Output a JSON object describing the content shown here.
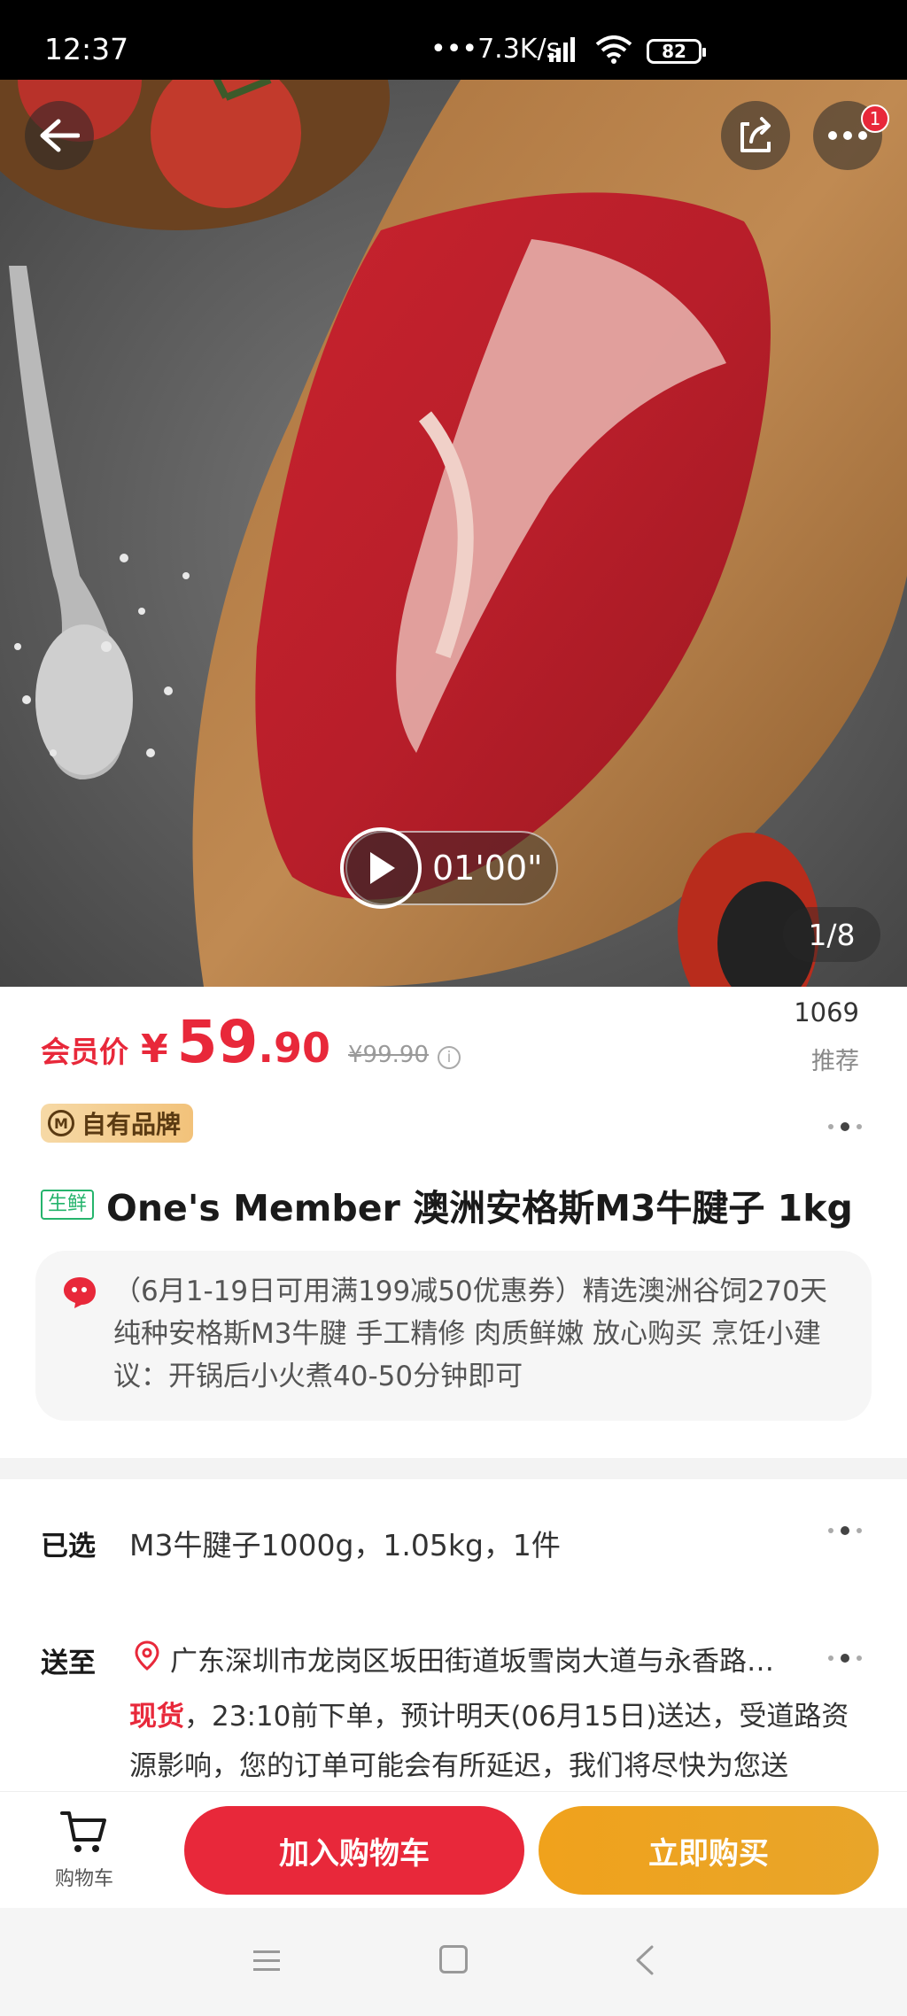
{
  "status_bar": {
    "time": "12:37",
    "net_speed": "•••7.3K/s",
    "battery": "82"
  },
  "hero": {
    "image_counter": "1/8",
    "video_duration": "01'00\"",
    "more_badge": "1"
  },
  "price": {
    "member_label": "会员价",
    "currency": "¥",
    "integer": "59",
    "decimal": ".90",
    "original": "¥99.90",
    "info_icon_text": "i"
  },
  "recommend": {
    "count": "1069",
    "label": "推荐"
  },
  "brand_tag": {
    "icon_text": "M",
    "label": "自有品牌"
  },
  "product": {
    "fresh_tag": "生鲜",
    "title": "One's Member 澳洲安格斯M3牛腱子 1kg",
    "description": "（6月1-19日可用满199减50优惠券）精选澳洲谷饲270天纯种安格斯M3牛腱 手工精修 肉质鲜嫩 放心购买 烹饪小建议：开锅后小火煮40-50分钟即可"
  },
  "selection": {
    "label": "已选",
    "value": "M3牛腱子1000g，1.05kg，1件"
  },
  "delivery": {
    "label": "送至",
    "address": "广东深圳市龙岗区坂田街道坂雪岗大道与永香路…",
    "stock": "现货",
    "text": "，23:10前下单，预计明天(06月15日)送达，受道路资源影响，您的订单可能会有所延迟，我们将尽快为您送"
  },
  "actions": {
    "cart_label": "购物车",
    "add_to_cart": "加入购物车",
    "buy_now": "立即购买"
  },
  "colors": {
    "accent_red": "#e8283a",
    "accent_orange": "#f0a21c",
    "fresh_green": "#25b46c"
  }
}
